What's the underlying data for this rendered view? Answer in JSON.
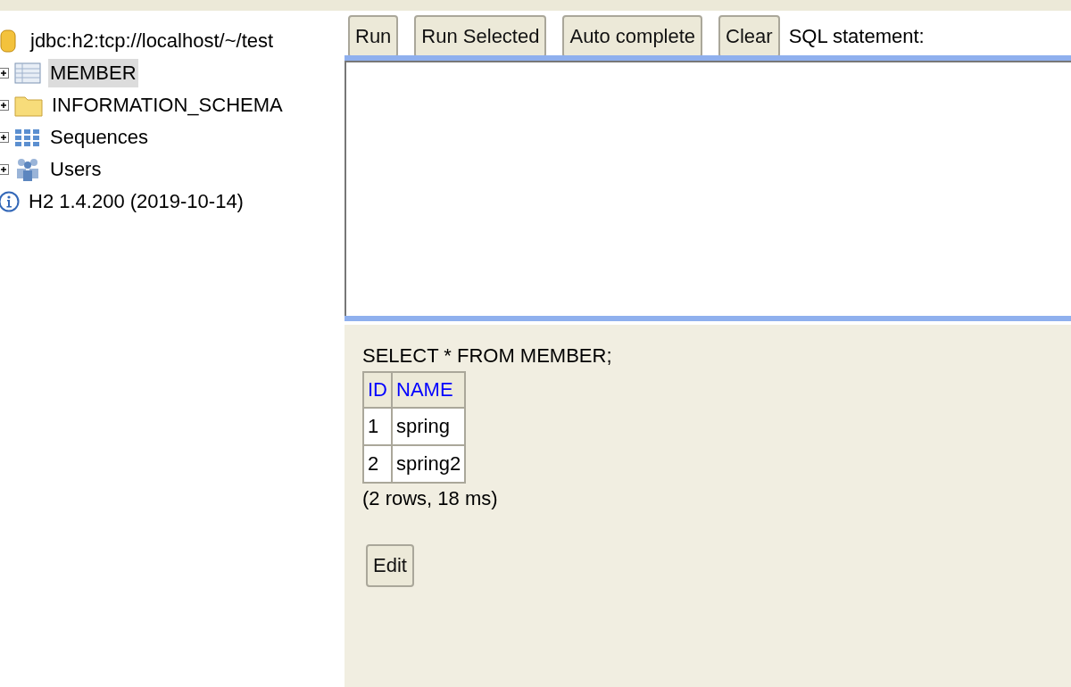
{
  "tree": {
    "connection": {
      "kind": "connection",
      "label": "jdbc:h2:tcp://localhost/~/test"
    },
    "items": [
      {
        "kind": "table",
        "label": "MEMBER",
        "selected": true,
        "expandable": true
      },
      {
        "kind": "folder",
        "label": "INFORMATION_SCHEMA",
        "selected": false,
        "expandable": true
      },
      {
        "kind": "sequences",
        "label": "Sequences",
        "selected": false,
        "expandable": true
      },
      {
        "kind": "users",
        "label": "Users",
        "selected": false,
        "expandable": true
      }
    ],
    "version": {
      "kind": "info",
      "label": "H2 1.4.200 (2019-10-14)"
    }
  },
  "toolbar": {
    "buttons": [
      "Run",
      "Run Selected",
      "Auto complete",
      "Clear"
    ],
    "label": "SQL statement:"
  },
  "result": {
    "statement": "SELECT * FROM MEMBER;",
    "columns": [
      "ID",
      "NAME"
    ],
    "rows": [
      [
        "1",
        "spring"
      ],
      [
        "2",
        "spring2"
      ]
    ],
    "summary": "(2 rows, 18 ms)",
    "button": "Edit"
  }
}
